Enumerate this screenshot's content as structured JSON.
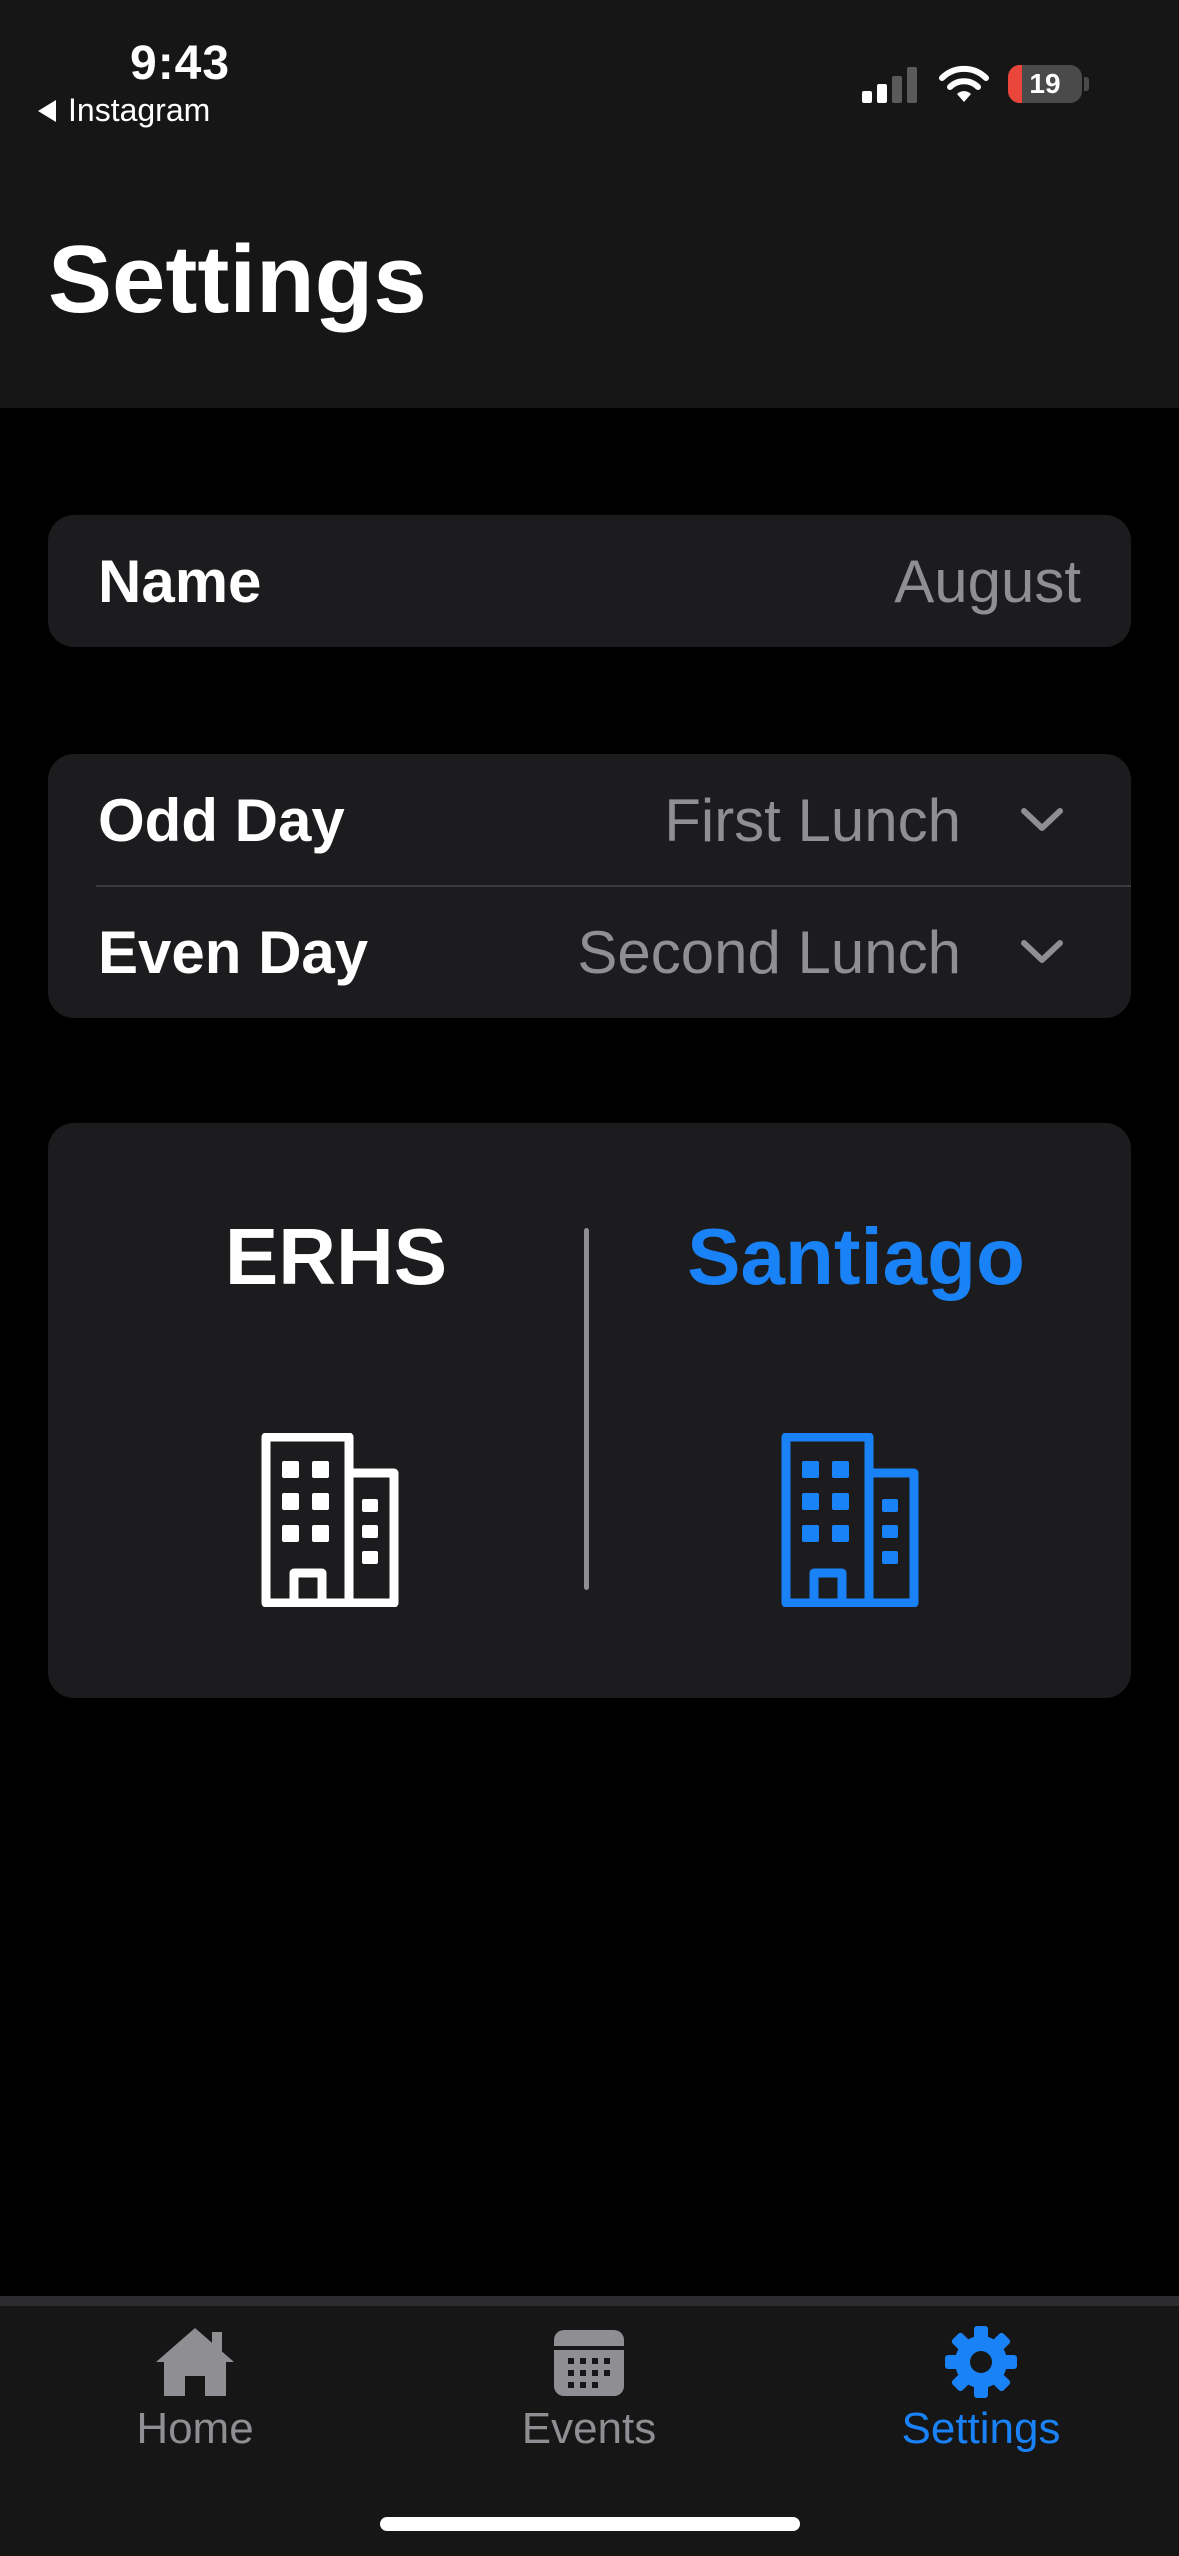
{
  "status_bar": {
    "time": "9:43",
    "back_app": "Instagram",
    "battery_level": "19",
    "battery_percent": 19
  },
  "header": {
    "title": "Settings"
  },
  "name_section": {
    "label": "Name",
    "value": "August"
  },
  "lunch_section": {
    "odd_day_label": "Odd Day",
    "odd_day_value": "First Lunch",
    "even_day_label": "Even Day",
    "even_day_value": "Second Lunch"
  },
  "school_section": {
    "options": [
      {
        "name": "ERHS",
        "selected": false
      },
      {
        "name": "Santiago",
        "selected": true
      }
    ]
  },
  "tab_bar": {
    "tabs": [
      {
        "label": "Home",
        "icon": "house-icon",
        "active": false
      },
      {
        "label": "Events",
        "icon": "calendar-icon",
        "active": false
      },
      {
        "label": "Settings",
        "icon": "gear-icon",
        "active": true
      }
    ]
  },
  "colors": {
    "accent": "#1a82f7",
    "inactive": "#8e8e93",
    "battery_low": "#e9453b"
  }
}
